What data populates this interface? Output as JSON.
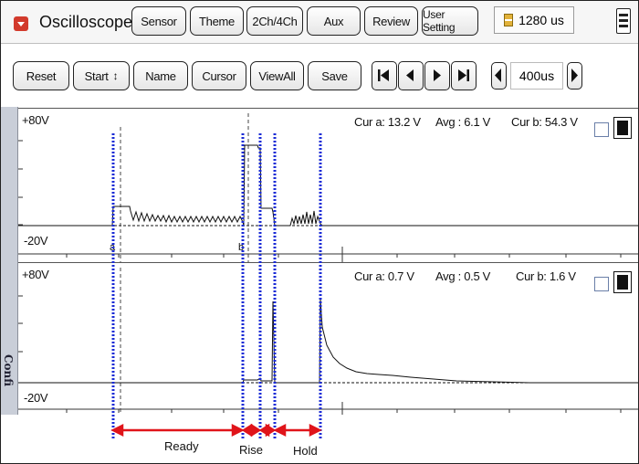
{
  "app": {
    "title": "Oscilloscope"
  },
  "top_buttons": [
    "Sensor",
    "Theme",
    "2Ch/4Ch",
    "Aux",
    "Review",
    "User Setting"
  ],
  "time_readout": {
    "icon": "hourglass-icon",
    "value": "1280 us"
  },
  "menu_icon": "hamburger-menu-icon",
  "toolbar": {
    "reset": "Reset",
    "start": "Start",
    "start_arrows": "↕",
    "name": "Name",
    "cursor": "Cursor",
    "view_all": "ViewAll",
    "save": "Save",
    "timebase": "400us"
  },
  "channel1": {
    "max_label": "+80V",
    "min_label": "-20V",
    "cursor_a": "Cur a: 13.2 V",
    "avg": "Avg : 6.1 V",
    "cursor_b": "Cur b: 54.3 V",
    "marker_a": "a",
    "marker_b": "b"
  },
  "channel2": {
    "max_label": "+80V",
    "min_label": "-20V",
    "cursor_a": "Cur a: 0.7 V",
    "avg": "Avg : 0.5 V",
    "cursor_b": "Cur b: 1.6 V"
  },
  "sidebar_label": "Confi",
  "phases": {
    "ready": "Ready",
    "rise": "Rise",
    "hold": "Hold"
  },
  "colors": {
    "annotation_blue": "#1a2bd6",
    "annotation_red": "#e0141a",
    "trace": "#111111"
  }
}
